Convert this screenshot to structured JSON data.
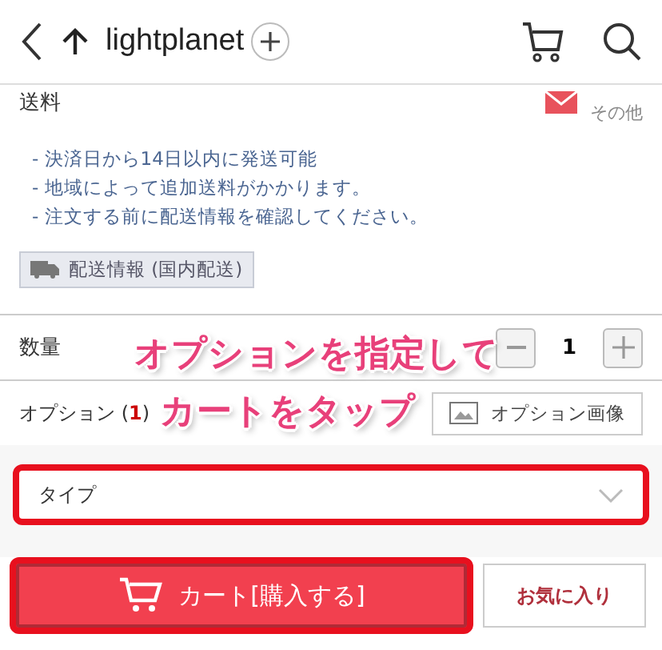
{
  "header": {
    "title": "lightplanet"
  },
  "shipping": {
    "label": "送料",
    "method": "その他",
    "notes": [
      "- 決済日から14日以内に発送可能",
      "- 地域によって追加送料がかかります。",
      "- 注文する前に配送情報を確認してください。"
    ],
    "info_button": "配送情報 (国内配送)"
  },
  "quantity": {
    "label": "数量",
    "value": "1"
  },
  "option": {
    "label": "オプション (",
    "count": "1",
    "label_end": ")",
    "image_button": "オプション画像",
    "select": {
      "placeholder": "タイプ",
      "highlighted": true
    }
  },
  "actions": {
    "cart": {
      "label": "カート[購入する]",
      "highlighted": true
    },
    "favorite": "お気に入り"
  },
  "annotation": [
    "オプションを指定して",
    "カートをタップ"
  ]
}
